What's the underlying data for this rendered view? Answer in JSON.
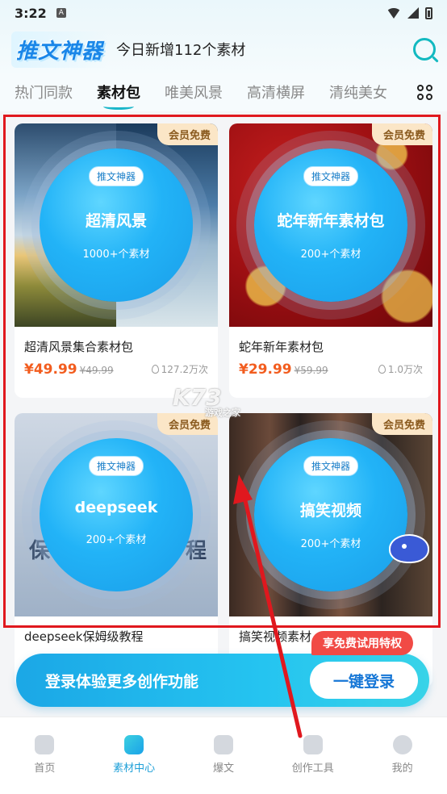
{
  "status": {
    "time": "3:22",
    "notif_letter": "A"
  },
  "header": {
    "logo": "推文神器",
    "subtitle": "今日新增112个素材"
  },
  "tabs": [
    "热门同款",
    "素材包",
    "唯美风景",
    "高清横屏",
    "清纯美女"
  ],
  "cards": [
    {
      "badge": "会员免费",
      "tag": "推文神器",
      "title": "超清风景",
      "count": "1000+个素材",
      "name": "超清风景集合素材包",
      "price": "¥49.99",
      "orig": "¥49.99",
      "views": "127.2万次"
    },
    {
      "badge": "会员免费",
      "tag": "推文神器",
      "title": "蛇年新年素材包",
      "count": "200+个素材",
      "name": "蛇年新年素材包",
      "price": "¥29.99",
      "orig": "¥59.99",
      "views": "1.0万次"
    },
    {
      "badge": "会员免费",
      "tag": "推文神器",
      "title": "deepseek",
      "count": "200+个素材",
      "name": "deepseek保姆级教程",
      "side_left": "保",
      "side_right": "程"
    },
    {
      "badge": "会员免费",
      "tag": "推文神器",
      "title": "搞笑视频",
      "count": "200+个素材",
      "name": "搞笑视频素材"
    }
  ],
  "trial_badge": "享免费试用特权",
  "login": {
    "text": "登录体验更多创作功能",
    "button": "一键登录"
  },
  "nav": [
    {
      "label": "首页"
    },
    {
      "label": "素材中心"
    },
    {
      "label": "爆文"
    },
    {
      "label": "创作工具"
    },
    {
      "label": "我的"
    }
  ],
  "watermark": {
    "main": "K73",
    "sub": "游戏之家"
  },
  "colors": {
    "accent": "#1aa2e8",
    "price": "#f25d1f",
    "highlight": "#e0181e"
  }
}
